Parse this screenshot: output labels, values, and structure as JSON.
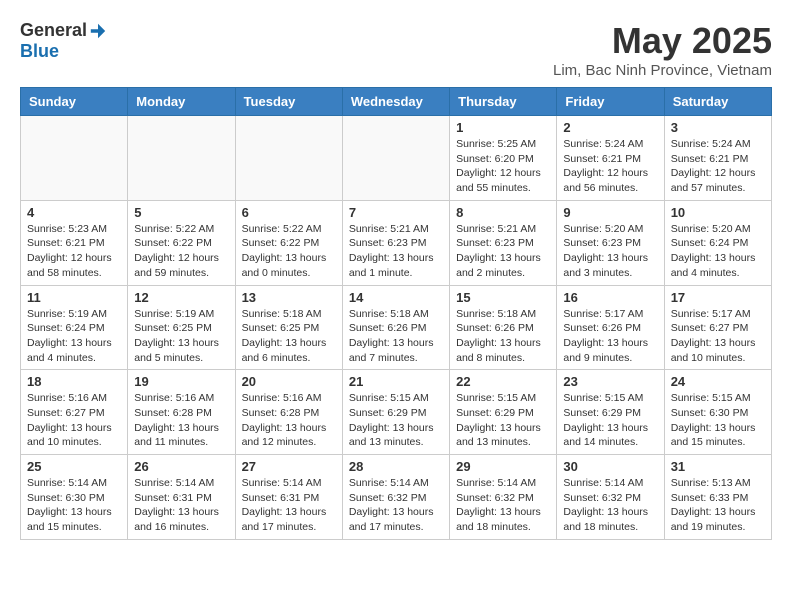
{
  "header": {
    "logo": {
      "general": "General",
      "blue": "Blue"
    },
    "title": "May 2025",
    "location": "Lim, Bac Ninh Province, Vietnam"
  },
  "weekdays": [
    "Sunday",
    "Monday",
    "Tuesday",
    "Wednesday",
    "Thursday",
    "Friday",
    "Saturday"
  ],
  "weeks": [
    [
      {
        "day": "",
        "info": ""
      },
      {
        "day": "",
        "info": ""
      },
      {
        "day": "",
        "info": ""
      },
      {
        "day": "",
        "info": ""
      },
      {
        "day": "1",
        "info": "Sunrise: 5:25 AM\nSunset: 6:20 PM\nDaylight: 12 hours\nand 55 minutes."
      },
      {
        "day": "2",
        "info": "Sunrise: 5:24 AM\nSunset: 6:21 PM\nDaylight: 12 hours\nand 56 minutes."
      },
      {
        "day": "3",
        "info": "Sunrise: 5:24 AM\nSunset: 6:21 PM\nDaylight: 12 hours\nand 57 minutes."
      }
    ],
    [
      {
        "day": "4",
        "info": "Sunrise: 5:23 AM\nSunset: 6:21 PM\nDaylight: 12 hours\nand 58 minutes."
      },
      {
        "day": "5",
        "info": "Sunrise: 5:22 AM\nSunset: 6:22 PM\nDaylight: 12 hours\nand 59 minutes."
      },
      {
        "day": "6",
        "info": "Sunrise: 5:22 AM\nSunset: 6:22 PM\nDaylight: 13 hours\nand 0 minutes."
      },
      {
        "day": "7",
        "info": "Sunrise: 5:21 AM\nSunset: 6:23 PM\nDaylight: 13 hours\nand 1 minute."
      },
      {
        "day": "8",
        "info": "Sunrise: 5:21 AM\nSunset: 6:23 PM\nDaylight: 13 hours\nand 2 minutes."
      },
      {
        "day": "9",
        "info": "Sunrise: 5:20 AM\nSunset: 6:23 PM\nDaylight: 13 hours\nand 3 minutes."
      },
      {
        "day": "10",
        "info": "Sunrise: 5:20 AM\nSunset: 6:24 PM\nDaylight: 13 hours\nand 4 minutes."
      }
    ],
    [
      {
        "day": "11",
        "info": "Sunrise: 5:19 AM\nSunset: 6:24 PM\nDaylight: 13 hours\nand 4 minutes."
      },
      {
        "day": "12",
        "info": "Sunrise: 5:19 AM\nSunset: 6:25 PM\nDaylight: 13 hours\nand 5 minutes."
      },
      {
        "day": "13",
        "info": "Sunrise: 5:18 AM\nSunset: 6:25 PM\nDaylight: 13 hours\nand 6 minutes."
      },
      {
        "day": "14",
        "info": "Sunrise: 5:18 AM\nSunset: 6:26 PM\nDaylight: 13 hours\nand 7 minutes."
      },
      {
        "day": "15",
        "info": "Sunrise: 5:18 AM\nSunset: 6:26 PM\nDaylight: 13 hours\nand 8 minutes."
      },
      {
        "day": "16",
        "info": "Sunrise: 5:17 AM\nSunset: 6:26 PM\nDaylight: 13 hours\nand 9 minutes."
      },
      {
        "day": "17",
        "info": "Sunrise: 5:17 AM\nSunset: 6:27 PM\nDaylight: 13 hours\nand 10 minutes."
      }
    ],
    [
      {
        "day": "18",
        "info": "Sunrise: 5:16 AM\nSunset: 6:27 PM\nDaylight: 13 hours\nand 10 minutes."
      },
      {
        "day": "19",
        "info": "Sunrise: 5:16 AM\nSunset: 6:28 PM\nDaylight: 13 hours\nand 11 minutes."
      },
      {
        "day": "20",
        "info": "Sunrise: 5:16 AM\nSunset: 6:28 PM\nDaylight: 13 hours\nand 12 minutes."
      },
      {
        "day": "21",
        "info": "Sunrise: 5:15 AM\nSunset: 6:29 PM\nDaylight: 13 hours\nand 13 minutes."
      },
      {
        "day": "22",
        "info": "Sunrise: 5:15 AM\nSunset: 6:29 PM\nDaylight: 13 hours\nand 13 minutes."
      },
      {
        "day": "23",
        "info": "Sunrise: 5:15 AM\nSunset: 6:29 PM\nDaylight: 13 hours\nand 14 minutes."
      },
      {
        "day": "24",
        "info": "Sunrise: 5:15 AM\nSunset: 6:30 PM\nDaylight: 13 hours\nand 15 minutes."
      }
    ],
    [
      {
        "day": "25",
        "info": "Sunrise: 5:14 AM\nSunset: 6:30 PM\nDaylight: 13 hours\nand 15 minutes."
      },
      {
        "day": "26",
        "info": "Sunrise: 5:14 AM\nSunset: 6:31 PM\nDaylight: 13 hours\nand 16 minutes."
      },
      {
        "day": "27",
        "info": "Sunrise: 5:14 AM\nSunset: 6:31 PM\nDaylight: 13 hours\nand 17 minutes."
      },
      {
        "day": "28",
        "info": "Sunrise: 5:14 AM\nSunset: 6:32 PM\nDaylight: 13 hours\nand 17 minutes."
      },
      {
        "day": "29",
        "info": "Sunrise: 5:14 AM\nSunset: 6:32 PM\nDaylight: 13 hours\nand 18 minutes."
      },
      {
        "day": "30",
        "info": "Sunrise: 5:14 AM\nSunset: 6:32 PM\nDaylight: 13 hours\nand 18 minutes."
      },
      {
        "day": "31",
        "info": "Sunrise: 5:13 AM\nSunset: 6:33 PM\nDaylight: 13 hours\nand 19 minutes."
      }
    ]
  ]
}
